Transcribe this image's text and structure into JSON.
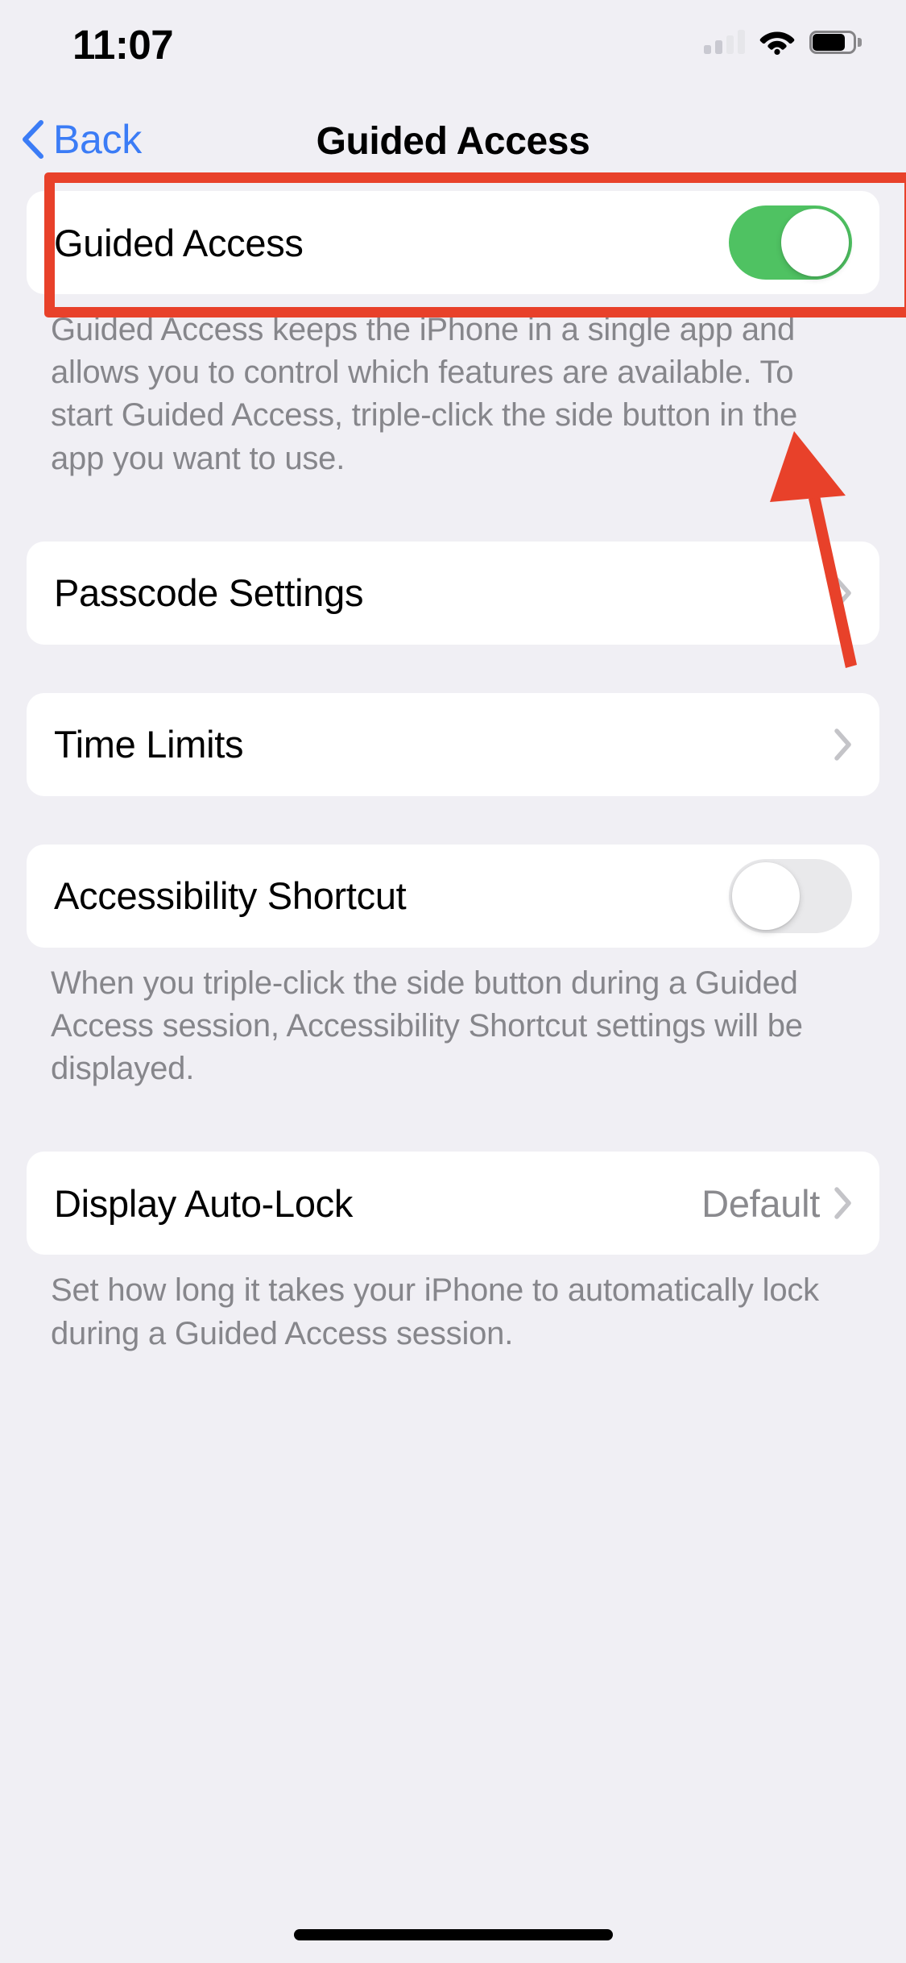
{
  "status_bar": {
    "time": "11:07",
    "cellular_icon": "cellular-signal-icon",
    "wifi_icon": "wifi-icon",
    "battery_icon": "battery-icon",
    "signal_bars_filled": 2,
    "signal_bars_total": 4,
    "battery_level_percent": 75
  },
  "nav": {
    "back_label": "Back",
    "back_icon": "chevron-left-icon",
    "title": "Guided Access"
  },
  "sections": {
    "guided_access": {
      "label": "Guided Access",
      "toggle_state": "on",
      "footnote": "Guided Access keeps the iPhone in a single app and allows you to control which features are available. To start Guided Access, triple-click the side button in the app you want to use."
    },
    "passcode_settings": {
      "label": "Passcode Settings",
      "chevron_icon": "chevron-right-icon"
    },
    "time_limits": {
      "label": "Time Limits",
      "chevron_icon": "chevron-right-icon"
    },
    "accessibility_shortcut": {
      "label": "Accessibility Shortcut",
      "toggle_state": "off",
      "footnote": "When you triple-click the side button during a Guided Access session, Accessibility Shortcut settings will be displayed."
    },
    "display_auto_lock": {
      "label": "Display Auto-Lock",
      "value": "Default",
      "chevron_icon": "chevron-right-icon",
      "footnote": "Set how long it takes your iPhone to automatically lock during a Guided Access session."
    }
  },
  "annotation": {
    "highlight_target": "guided-access-toggle-row",
    "arrow_icon": "arrow-up-annotation",
    "color": "#E8412A"
  },
  "colors": {
    "background": "#F0EFF4",
    "card": "#FFFFFF",
    "accent_blue": "#3B7CF6",
    "toggle_on_green": "#4FC262",
    "toggle_off_gray": "#E9E9EB",
    "footnote_gray": "#86868B",
    "value_gray": "#8A8A8E",
    "annotation_red": "#E8412A"
  }
}
